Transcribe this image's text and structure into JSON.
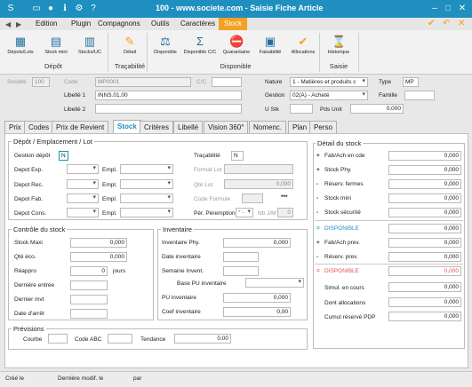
{
  "window": {
    "title": "100 - www.societe.com - Saisie Fiche Article"
  },
  "menu": [
    "Edition",
    "Plugin",
    "Compagnons",
    "Outils",
    "Caractères",
    "Stock"
  ],
  "ribbon": {
    "depot_buttons": [
      "Dépots/Lots",
      "Stock mini",
      "Stocks/UC"
    ],
    "depot_group": "Dépôt",
    "trace_buttons": [
      "Détail"
    ],
    "trace_group": "Traçabilité",
    "dispo_buttons": [
      "Disponible",
      "Disponible C/C",
      "Quarantaine",
      "Faisabilité",
      "Allocations"
    ],
    "dispo_group": "Disponible",
    "saisie_buttons": [
      "Historique"
    ],
    "saisie_group": "Saisie"
  },
  "header": {
    "societe_label": "Société",
    "societe_value": "100",
    "code_label": "Code",
    "code_value": "MP0001",
    "cc_label": "C/C",
    "libelle1_label": "Libellé 1",
    "libelle1_value": "INNS.01.00",
    "libelle2_label": "Libellé 2",
    "nature_label": "Nature",
    "nature_value": "1 - Matières et produits c",
    "gestion_label": "Gestion",
    "gestion_value": "02(A) - Acheté",
    "type_label": "Type",
    "type_value": "MP",
    "famille_label": "Famille",
    "ustk_label": "U Stk",
    "pdsunit_label": "Pds Unit",
    "pdsunit_value": "0,000"
  },
  "tabs": [
    "Prix",
    "Codes",
    "Prix de Revient",
    "Stock",
    "Critères",
    "Libellé",
    "Vision 360°",
    "Nomenc.",
    "Plan",
    "Perso"
  ],
  "depot_section": {
    "title": "Dépôt / Emplacement / Lot",
    "gestion_depot_label": "Gestion dépôt",
    "gestion_depot_value": "N",
    "tracabilite_label": "Traçabilité",
    "tracabilite_value": "N",
    "rows": [
      "Depot Exp.",
      "Depot Rec.",
      "Depot Fab.",
      "Depot Cons."
    ],
    "empl_label": "Empl.",
    "format_lot": "Format Lot",
    "qte_lot": "Qté Lot",
    "qte_lot_value": "0,000",
    "code_formule": "Code Formule",
    "stars": "***",
    "per_peremption": "Pér. Péremption",
    "per_value": "* -",
    "nb_jm": "Nb J/M",
    "nb_jm_value": "0"
  },
  "controle": {
    "title": "Contrôle du stock",
    "stock_maxi": "Stock Maxi",
    "stock_maxi_value": "0,000",
    "qte_eco": "Qté éco.",
    "qte_eco_value": "0,000",
    "reappro": "Réappro",
    "reappro_value": "0",
    "jours": "jours",
    "derniere_entree": "Dernière entrée",
    "dernier_mvt": "Dernier mvt",
    "date_arret": "Date d'arrêt"
  },
  "inventaire": {
    "title": "Inventaire",
    "phy": "Inventaire Phy.",
    "phy_value": "0,000",
    "date": "Date inventaire",
    "semaine": "Semaine Invent.",
    "base_pu": "Base PU inventaire",
    "pu": "PU inventaire",
    "pu_value": "0,000",
    "coef": "Coef inventaire",
    "coef_value": "0,00"
  },
  "previsions": {
    "title": "Prévisions",
    "courbe": "Courbe",
    "code_abc": "Code ABC",
    "tendance": "Tendance",
    "tendance_value": "0,00"
  },
  "detail_stock": {
    "title": "Détail du stock",
    "rows1": [
      {
        "sign": "+",
        "label": "Fab/Ach en cde",
        "value": "0,000"
      },
      {
        "sign": "+",
        "label": "Stock Phy.",
        "value": "0,000"
      },
      {
        "sign": "-",
        "label": "Réserv. fermes",
        "value": "0,000"
      },
      {
        "sign": "-",
        "label": "Stock mini",
        "value": "0,000"
      },
      {
        "sign": "-",
        "label": "Stock sécurité",
        "value": "0,000"
      }
    ],
    "dispo1": {
      "sign": "=",
      "label": "DISPONIBLE",
      "value": "0,000"
    },
    "rows2": [
      {
        "sign": "+",
        "label": "Fab/Ach prev.",
        "value": "0,000"
      },
      {
        "sign": "-",
        "label": "Réserv. prev.",
        "value": "0,000"
      }
    ],
    "dispo2": {
      "sign": "=",
      "label": "DISPONIBLE",
      "value": "0,000"
    },
    "rows3": [
      {
        "label": "Simul. en cours",
        "value": "0,000"
      },
      {
        "label": "Dont allocations",
        "value": "0,000"
      },
      {
        "label": "Cumul réservé PDP",
        "value": "0,000"
      }
    ]
  },
  "status": {
    "cree": "Créé le",
    "modif": "Dernière modif. le",
    "par": "par"
  },
  "colors": {
    "accent": "#1e8fbf",
    "stock_tab": "#f6a021",
    "disponible": "#1e8fbf",
    "disponible2": "#e05050"
  }
}
